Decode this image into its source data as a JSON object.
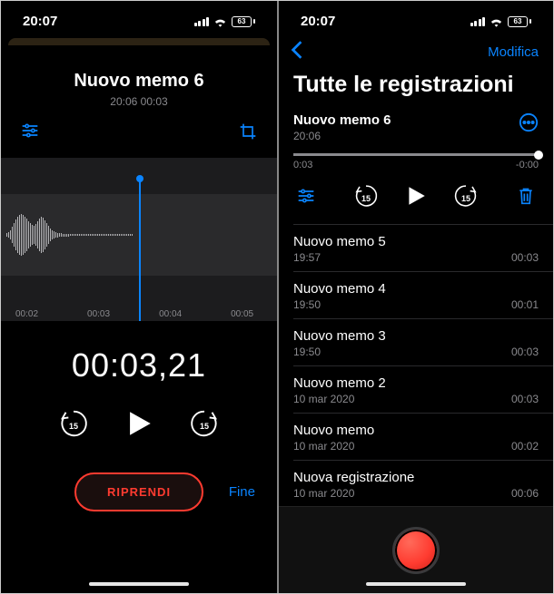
{
  "status": {
    "time": "20:07",
    "battery": "63"
  },
  "left": {
    "title": "Nuovo memo 6",
    "subtitle": "20:06  00:03",
    "ticks": [
      "00:02",
      "00:03",
      "00:04",
      "00:05"
    ],
    "bigTime": "00:03,21",
    "skipBack": "15",
    "skipFwd": "15",
    "resume": "RIPRENDI",
    "done": "Fine"
  },
  "right": {
    "edit": "Modifica",
    "heading": "Tutte le registrazioni",
    "current": {
      "title": "Nuovo memo 6",
      "subtitle": "20:06",
      "elapsed": "0:03",
      "remaining": "-0:00",
      "skipBack": "15",
      "skipFwd": "15"
    },
    "items": [
      {
        "title": "Nuovo memo 5",
        "sub": "19:57",
        "dur": "00:03"
      },
      {
        "title": "Nuovo memo 4",
        "sub": "19:50",
        "dur": "00:01"
      },
      {
        "title": "Nuovo memo 3",
        "sub": "19:50",
        "dur": "00:03"
      },
      {
        "title": "Nuovo memo 2",
        "sub": "10 mar 2020",
        "dur": "00:03"
      },
      {
        "title": "Nuovo memo",
        "sub": "10 mar 2020",
        "dur": "00:02"
      },
      {
        "title": "Nuova registrazione",
        "sub": "10 mar 2020",
        "dur": "00:06"
      }
    ]
  }
}
